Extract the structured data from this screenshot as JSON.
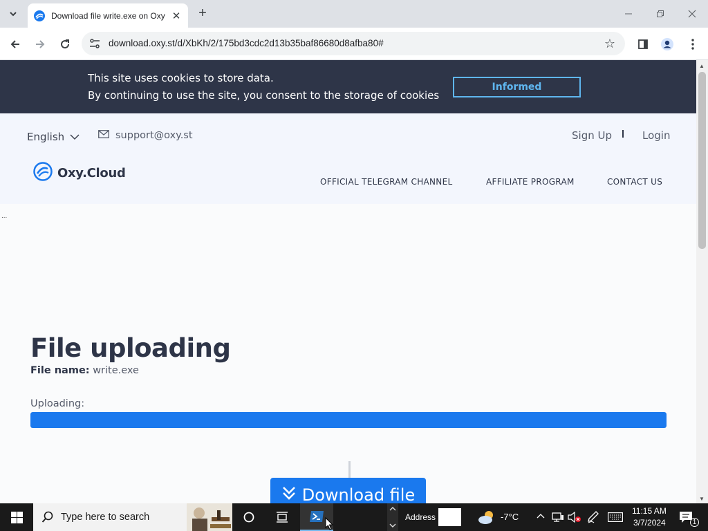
{
  "browser": {
    "tab_title": "Download file write.exe on Oxy",
    "tab_close": "✕",
    "new_tab": "+",
    "url": "download.oxy.st/d/XbKh/2/175bd3cdc2d13b35baf86680d8afba80#",
    "icons": [
      "tab-search-icon",
      "back-icon",
      "forward-icon",
      "reload-icon",
      "site-info-icon",
      "star-icon",
      "sidebar-icon",
      "profile-icon",
      "menu-icon",
      "minimize-icon",
      "restore-icon",
      "close-icon"
    ]
  },
  "cookie": {
    "line1": "This site uses cookies to store data.",
    "line2": "By continuing to use the site, you consent to the storage of cookies",
    "button": "Informed"
  },
  "header": {
    "language": "English",
    "support_email": "support@oxy.st",
    "sign_up": "Sign Up",
    "login": "Login",
    "logo_text": "Oxy.Cloud",
    "nav": [
      "OFFICIAL TELEGRAM CHANNEL",
      "AFFILIATE PROGRAM",
      "CONTACT US"
    ]
  },
  "main": {
    "title": "File uploading",
    "file_name_label": "File name:",
    "file_name": "write.exe",
    "uploading_label": "Uploading:",
    "progress": 1.0,
    "download_button": "Download file",
    "left_mark": "..."
  },
  "taskbar": {
    "search_placeholder": "Type here to search",
    "address_label": "Address",
    "weather": "-7°C",
    "time": "11:15 AM",
    "date": "3/7/2024",
    "notification_count": "1"
  },
  "colors": {
    "accent": "#1a79ee",
    "cookie_bg": "#2e3548",
    "cookie_button": "#5fb6ef"
  }
}
